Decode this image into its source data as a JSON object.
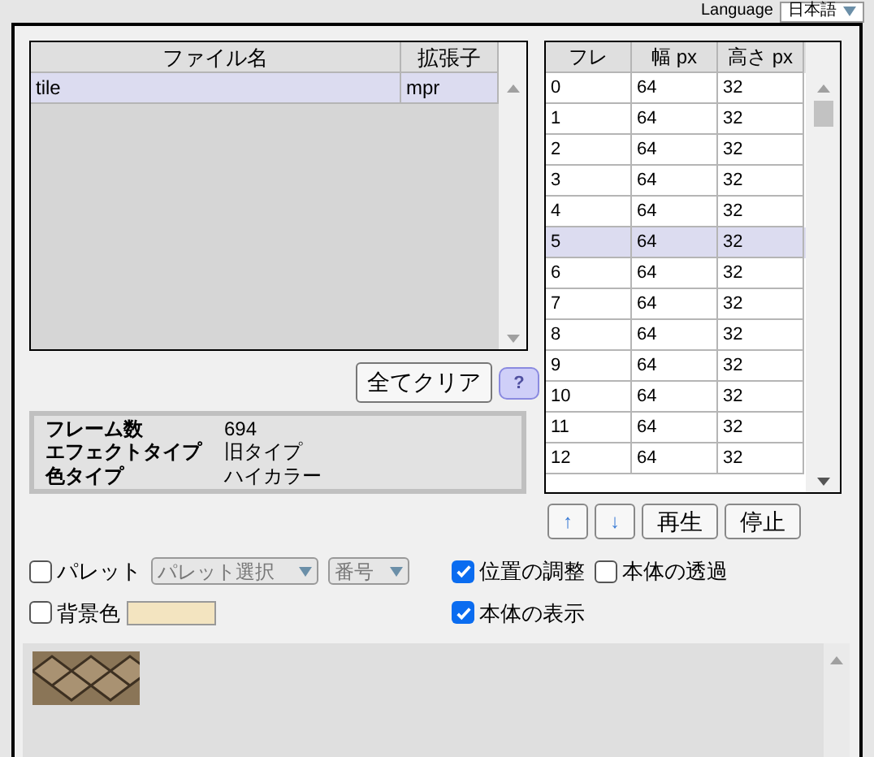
{
  "language": {
    "label": "Language",
    "value": "日本語"
  },
  "file_list": {
    "columns": [
      "ファイル名",
      "拡張子"
    ],
    "rows": [
      {
        "cells": [
          "tile",
          "mpr"
        ],
        "selected": true
      }
    ]
  },
  "clear_button": "全てクリア",
  "help_button": "?",
  "info": [
    {
      "label": "フレーム数",
      "value": "694"
    },
    {
      "label": "エフェクトタイプ",
      "value": "旧タイプ"
    },
    {
      "label": "色タイプ",
      "value": "ハイカラー"
    }
  ],
  "frames": {
    "columns": [
      "フレ",
      "幅 px",
      "高さ px"
    ],
    "rows": [
      {
        "cells": [
          "0",
          "64",
          "32"
        ],
        "selected": false
      },
      {
        "cells": [
          "1",
          "64",
          "32"
        ],
        "selected": false
      },
      {
        "cells": [
          "2",
          "64",
          "32"
        ],
        "selected": false
      },
      {
        "cells": [
          "3",
          "64",
          "32"
        ],
        "selected": false
      },
      {
        "cells": [
          "4",
          "64",
          "32"
        ],
        "selected": false
      },
      {
        "cells": [
          "5",
          "64",
          "32"
        ],
        "selected": true
      },
      {
        "cells": [
          "6",
          "64",
          "32"
        ],
        "selected": false
      },
      {
        "cells": [
          "7",
          "64",
          "32"
        ],
        "selected": false
      },
      {
        "cells": [
          "8",
          "64",
          "32"
        ],
        "selected": false
      },
      {
        "cells": [
          "9",
          "64",
          "32"
        ],
        "selected": false
      },
      {
        "cells": [
          "10",
          "64",
          "32"
        ],
        "selected": false
      },
      {
        "cells": [
          "11",
          "64",
          "32"
        ],
        "selected": false
      },
      {
        "cells": [
          "12",
          "64",
          "32"
        ],
        "selected": false
      }
    ]
  },
  "frame_buttons": [
    "↑",
    "↓",
    "再生",
    "停止"
  ],
  "palette": {
    "label": "パレット",
    "checked": false,
    "select": "パレット選択",
    "number": "番号"
  },
  "background": {
    "label": "背景色",
    "checked": false,
    "color": "#f3e4c0"
  },
  "options": [
    {
      "label": "位置の調整",
      "checked": true
    },
    {
      "label": "本体の透過",
      "checked": false
    },
    {
      "label": "本体の表示",
      "checked": true
    }
  ]
}
